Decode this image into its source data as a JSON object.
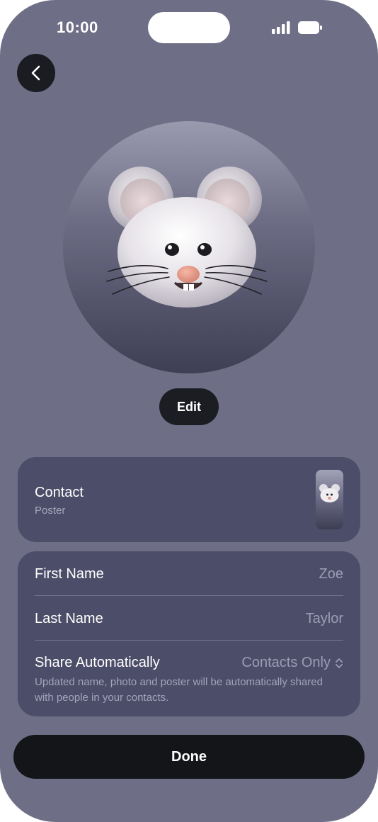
{
  "status_bar": {
    "time": "10:00",
    "signal_icon": "signal-bars-icon",
    "battery_icon": "battery-icon"
  },
  "nav": {
    "back_icon": "chevron-left-icon"
  },
  "avatar": {
    "character": "mouse memoji"
  },
  "edit_label": "Edit",
  "poster": {
    "title": "Contact",
    "subtitle": "Poster"
  },
  "form": {
    "first_name_label": "First Name",
    "first_name_value": "Zoe",
    "last_name_label": "Last Name",
    "last_name_value": "Taylor",
    "share_label": "Share Automatically",
    "share_value": "Contacts Only",
    "share_icon": "chevron-up-down-icon",
    "help_text": "Updated name, photo and poster will be automatically shared with people in your contacts."
  },
  "done_label": "Done",
  "colors": {
    "background": "#6e6e86",
    "card": "#4c4d68",
    "button_dark": "#141519"
  }
}
